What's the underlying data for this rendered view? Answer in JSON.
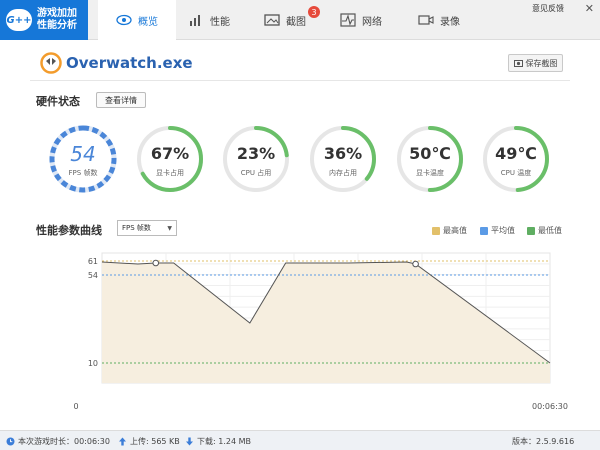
{
  "app": {
    "logo_badge": "G++",
    "logo_line1": "游戏加加",
    "logo_line2": "性能分析"
  },
  "tabs": [
    {
      "label": "概览",
      "active": true
    },
    {
      "label": "性能",
      "active": false
    },
    {
      "label": "截图",
      "active": false,
      "badge": "3"
    },
    {
      "label": "网络",
      "active": false
    },
    {
      "label": "录像",
      "active": false
    }
  ],
  "header": {
    "feedback": "意见反馈",
    "close": "✕"
  },
  "game": {
    "title": "Overwatch.exe",
    "screenshot_button": "保存截图"
  },
  "hardware": {
    "title": "硬件状态",
    "detail_button": "查看详情",
    "gauges": [
      {
        "value": "54",
        "label": "FPS 帧数",
        "percent": 0.85,
        "color": "#4a86d8"
      },
      {
        "value": "67%",
        "label": "显卡占用",
        "percent": 0.67,
        "color": "#6abf69"
      },
      {
        "value": "23%",
        "label": "CPU 占用",
        "percent": 0.23,
        "color": "#6abf69"
      },
      {
        "value": "36%",
        "label": "内存占用",
        "percent": 0.36,
        "color": "#6abf69"
      },
      {
        "value": "50℃",
        "label": "显卡温度",
        "percent": 0.5,
        "color": "#6abf69"
      },
      {
        "value": "49℃",
        "label": "CPU 温度",
        "percent": 0.49,
        "color": "#6abf69"
      }
    ]
  },
  "perf": {
    "title": "性能参数曲线",
    "select_value": "FPS 帧数",
    "legend": [
      {
        "label": "最高值",
        "color": "#e2c06a"
      },
      {
        "label": "平均值",
        "color": "#5b9be6"
      },
      {
        "label": "最低值",
        "color": "#5fae62"
      }
    ]
  },
  "chart_data": {
    "type": "line",
    "x_start_label": "0",
    "x_end_label": "00:06:30",
    "ytick_labels": [
      "61",
      "54",
      "10"
    ],
    "ylim": [
      0,
      65
    ],
    "max_value": 61,
    "avg_value": 54,
    "min_value": 10,
    "points": [
      {
        "t": 0.0,
        "fps": 60.5
      },
      {
        "t": 0.08,
        "fps": 59.5
      },
      {
        "t": 0.12,
        "fps": 60
      },
      {
        "t": 0.16,
        "fps": 60
      },
      {
        "t": 0.33,
        "fps": 30
      },
      {
        "t": 0.41,
        "fps": 60
      },
      {
        "t": 0.55,
        "fps": 60
      },
      {
        "t": 0.68,
        "fps": 60.5
      },
      {
        "t": 0.7,
        "fps": 59.5
      },
      {
        "t": 1.0,
        "fps": 10
      }
    ],
    "markers": [
      {
        "t": 0.12,
        "fps": 60
      },
      {
        "t": 0.7,
        "fps": 59.5
      }
    ],
    "colors": {
      "line": "#555555",
      "fill": "#f6eedf",
      "max": "#e2c06a",
      "avg": "#5b9be6",
      "min": "#5fae62"
    }
  },
  "status": {
    "session_label": "本次游戏时长：00:06:30",
    "upload_label": "上传: 565 KB",
    "download_label": "下载: 1.24 MB",
    "version_label": "版本：2.5.9.616"
  }
}
